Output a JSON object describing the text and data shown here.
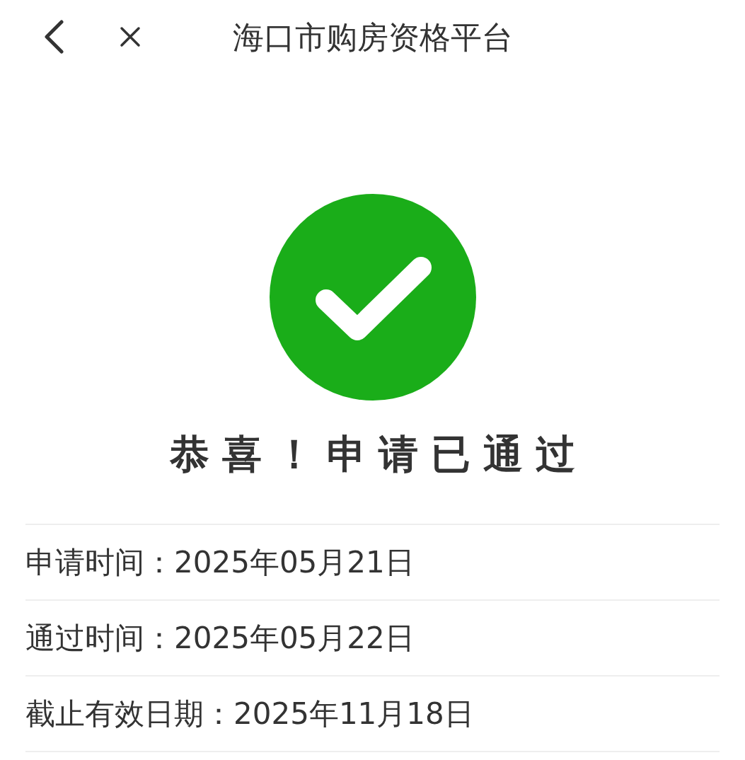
{
  "header": {
    "title": "海口市购房资格平台"
  },
  "result": {
    "approved": true,
    "message": "恭喜！申请已通过"
  },
  "details": [
    {
      "label": "申请时间：",
      "value": "2025年05月21日"
    },
    {
      "label": "通过时间：",
      "value": "2025年05月22日"
    },
    {
      "label": "截止有效日期：",
      "value": "2025年11月18日"
    }
  ]
}
